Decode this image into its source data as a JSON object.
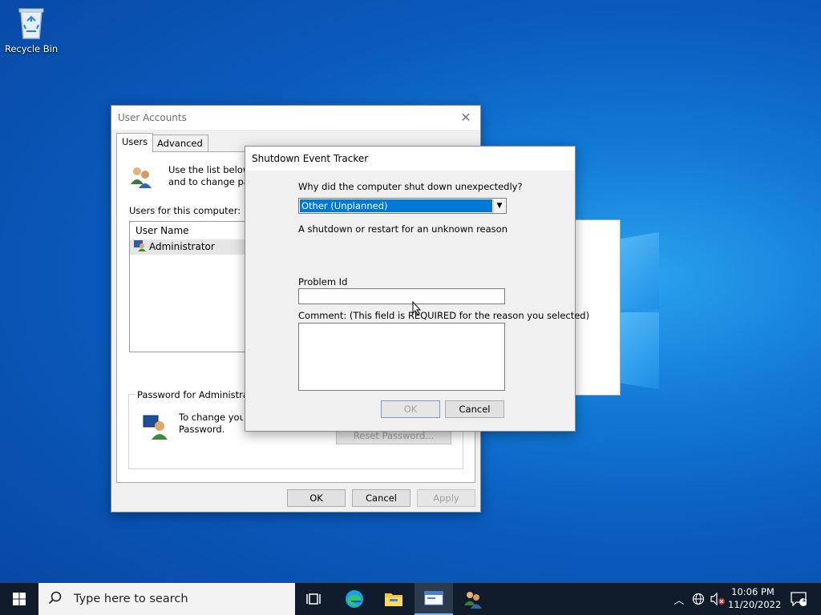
{
  "desktop": {
    "recycle_bin_label": "Recycle Bin"
  },
  "user_accounts": {
    "title": "User Accounts",
    "tabs": [
      {
        "label": "Users",
        "selected": true
      },
      {
        "label": "Advanced",
        "selected": false
      }
    ],
    "intro_line1": "Use the list below t",
    "intro_line2": "and to change pas",
    "users_label": "Users for this computer:",
    "list_header": "User Name",
    "users": [
      {
        "name": "Administrator"
      }
    ],
    "password_group_label": "Password for Administrator",
    "password_text_line1": "To change your",
    "password_text_line2": "Password.",
    "reset_password_label": "Reset Password...",
    "ok_label": "OK",
    "cancel_label": "Cancel",
    "apply_label": "Apply"
  },
  "shutdown_tracker": {
    "title": "Shutdown Event Tracker",
    "question": "Why did the computer shut down unexpectedly?",
    "reason_selected": "Other (Unplanned)",
    "reason_description": "A shutdown or restart for an unknown reason",
    "problem_id_label": "Problem Id",
    "problem_id_value": "",
    "comment_label": "Comment: (This field is REQUIRED for the reason you selected)",
    "comment_value": "",
    "ok_label": "OK",
    "cancel_label": "Cancel"
  },
  "taskbar": {
    "search_placeholder": "Type here to search",
    "time": "10:06 PM",
    "date": "11/20/2022",
    "notification_count": "1",
    "accent_color": "#0078d7"
  }
}
